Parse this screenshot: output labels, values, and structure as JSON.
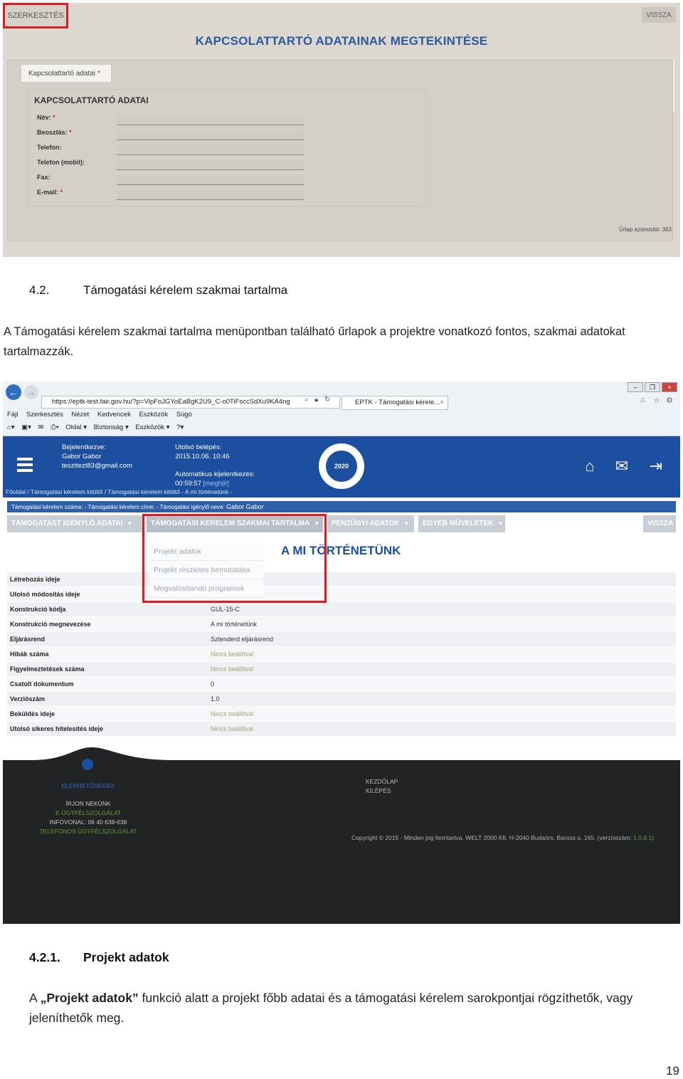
{
  "screenshot1": {
    "edit_button": "SZERKESZTÉS",
    "back_button": "VISSZA",
    "title": "KAPCSOLATTARTÓ ADATAINAK MEGTEKINTÉSE",
    "tab_label": "Kapcsolattartó adatai",
    "form_title": "KAPCSOLATTARTÓ ADATAI",
    "fields": [
      {
        "label": "Név:",
        "required": "*"
      },
      {
        "label": "Beosztás:",
        "required": "*"
      },
      {
        "label": "Telefon:",
        "required": ""
      },
      {
        "label": "Telefon (mobil):",
        "required": ""
      },
      {
        "label": "Fax:",
        "required": ""
      },
      {
        "label": "E-mail:",
        "required": "*"
      }
    ],
    "form_id": "Űrlap azonosító: 363"
  },
  "section": {
    "number": "4.2.",
    "title": "Támogatási kérelem szakmai tartalma",
    "paragraph": "A Támogatási kérelem szakmai tartalma menüpontban található űrlapok a projektre vonatkozó fontos, szakmai adatokat tartalmazzák."
  },
  "screenshot2": {
    "browser": {
      "url": "https://eptk-test.fair.gov.hu/?p=VlpFoJGYoEaBgK2U9_C-o0TiFsccSdXu9KA4ng",
      "tab_title": "EPTK - Támogatási kérele...",
      "menu": [
        "Fájl",
        "Szerkesztés",
        "Nézet",
        "Kedvencek",
        "Eszközök",
        "Súgó"
      ],
      "commands": [
        "Oldal ▾",
        "Biztonság ▾",
        "Eszközök ▾"
      ]
    },
    "header": {
      "logged_label": "Bejelentkezve:",
      "user_name": "Gabor Gabor",
      "user_email": "teszttezt83@gmail.com",
      "last_login_label": "Utolsó belépés:",
      "last_login": "2015.10.06. 10:46",
      "auto_logout_label": "Automatikus kijelentkezés:",
      "auto_logout_time": "00:59:57",
      "auto_logout_extend": "[meghjlr]",
      "logo_text": "2020",
      "breadcrumb": "Főoldal   /   Támogatási kérelem kitöltő   /   Támogatási kérelem kitöltő - A mi történetünk -"
    },
    "infobar": {
      "text": "Támogatási kérelem száma:  -  Támogatási kérelem címe:  -  Támogatási igénylő neve:",
      "name": "Gabor Gabor"
    },
    "tabs": [
      "TÁMOGATÁST IGÉNYLŐ ADATAI",
      "TÁMOGATÁSI KÉRELEM SZAKMAI TARTALMA",
      "PÉNZÜGYI ADATOK",
      "EGYÉB MŰVELETEK",
      "VISSZA"
    ],
    "dropdown": [
      "Projekt adatok",
      "Projekt részletes bemutatása",
      "Megvalósítandó programok"
    ],
    "page_title": "A MI TÖRTÉNETÜNK",
    "rows": [
      {
        "label": "Létrehozás ideje",
        "value": ""
      },
      {
        "label": "Utolsó módosítás ideje",
        "value": ""
      },
      {
        "label": "Konstrukció kódja",
        "value": "GUL-15-C"
      },
      {
        "label": "Konstrukció megnevezése",
        "value": "A mi történetünk"
      },
      {
        "label": "Eljárásrend",
        "value": "Sztenderd eljárásrend"
      },
      {
        "label": "Hibák száma",
        "value": "Nincs beállítva!"
      },
      {
        "label": "Figyelmeztetések száma",
        "value": "Nincs beállítva!"
      },
      {
        "label": "Csatolt dokumentum",
        "value": "0"
      },
      {
        "label": "Verziószám",
        "value": "1.0"
      },
      {
        "label": "Beküldés ideje",
        "value": "Nincs beállítva!"
      },
      {
        "label": "Utolsó sikeres hitelesítés ideje",
        "value": "Nincs beállítva!"
      }
    ],
    "footer": {
      "contacts_title": "ELÉRHETŐSÉGEK",
      "links": [
        "ÍRJON NEKÜNK",
        "E-ÜGYFÉLSZOLGÁLAT",
        "INFOVONAL: 06 40 638-638",
        "TELEFONOS ÜGYFÉLSZOLGÁLAT"
      ],
      "nav": [
        "KEZDŐLAP",
        "KILÉPÉS"
      ],
      "copyright": "Copyright © 2015 - Minden jog fenntartva. WELT 2000 Kft. H-2040 Budaörs, Baross u. 165. (verziószám:",
      "version": "1.0.9.1)"
    }
  },
  "subsection": {
    "number": "4.2.1.",
    "title": "Projekt adatok",
    "para_prefix": "A ",
    "para_bold": "„Projekt adatok”",
    "para_rest": " funkció alatt a projekt főbb adatai és a támogatási kérelem sarokpontjai rögzíthetők, vagy jeleníthetők meg."
  },
  "page_number": "19"
}
